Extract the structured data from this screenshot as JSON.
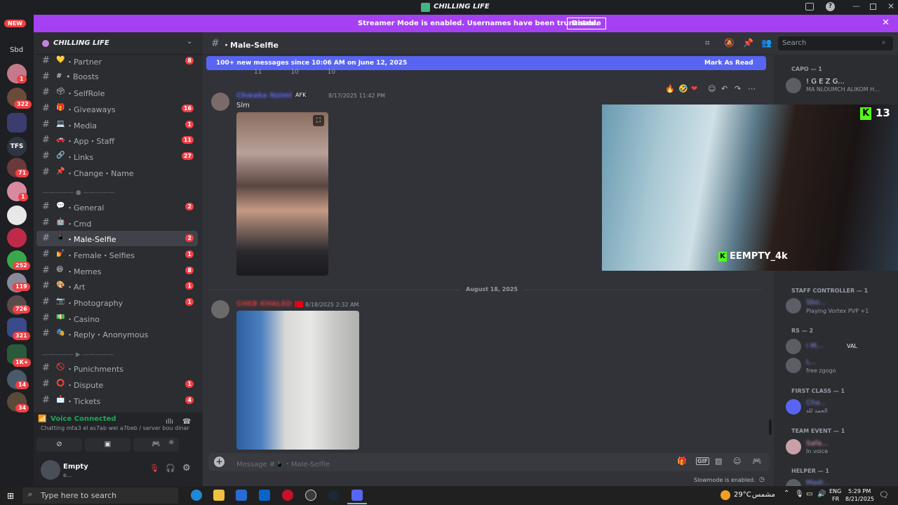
{
  "app": {
    "title": "CHILLING LIFE"
  },
  "banner": {
    "text": "Streamer Mode is enabled. Usernames have been truncated.",
    "button": "Disable"
  },
  "rail": {
    "new_label": "NEW",
    "sbd": "Sbd",
    "badges": [
      "1",
      "322",
      "71",
      "1",
      "252",
      "119",
      "726",
      "321",
      "1K+",
      "14",
      "34"
    ]
  },
  "sidebar": {
    "server_name": "CHILLING LIFE",
    "channels": [
      {
        "emoji": "💛",
        "name": "・Partner",
        "count": "8"
      },
      {
        "emoji": "#",
        "name": "• Boosts",
        "count": ""
      },
      {
        "emoji": "🗳",
        "name": "・SelfRole",
        "count": ""
      },
      {
        "emoji": "🎁",
        "name": "・Giveaways",
        "count": "16"
      },
      {
        "emoji": "💻",
        "name": "・Media",
        "count": "1"
      },
      {
        "emoji": "🚗",
        "name": "・App・Staff",
        "count": "11"
      },
      {
        "emoji": "🔗",
        "name": "・Links",
        "count": "27"
      },
      {
        "emoji": "📌",
        "name": "・Change・Name",
        "count": ""
      }
    ],
    "separator1": "————— ● —————",
    "channels2": [
      {
        "emoji": "💬",
        "name": "・General",
        "count": "2"
      },
      {
        "emoji": "🤖",
        "name": "・Cmd",
        "count": ""
      },
      {
        "emoji": "📱",
        "name": "・Male-Selfie",
        "count": "2",
        "active": true
      },
      {
        "emoji": "💅",
        "name": "・Female・Selfies",
        "count": "1"
      },
      {
        "emoji": "😆",
        "name": "・Memes",
        "count": "8"
      },
      {
        "emoji": "🎨",
        "name": "・Art",
        "count": "1"
      },
      {
        "emoji": "📷",
        "name": "・Photography",
        "count": "1"
      },
      {
        "emoji": "💵",
        "name": "・Casino",
        "count": ""
      },
      {
        "emoji": "🎭",
        "name": "・Reply・Anonymous",
        "count": ""
      }
    ],
    "separator2": "————— ▶ —————",
    "channels3": [
      {
        "emoji": "🚫",
        "name": "・Punichments",
        "count": ""
      },
      {
        "emoji": "⭕",
        "name": "・Dispute",
        "count": "1"
      },
      {
        "emoji": "📩",
        "name": "・Tickets",
        "count": "4"
      }
    ]
  },
  "voice": {
    "status": "Voice Connected",
    "channel": "Chatting mta3 el as7ab wel a7beb / server bou dinar"
  },
  "user": {
    "name": "Empty",
    "tag": "e..."
  },
  "chat": {
    "channel": "・Male-Selfie",
    "search_placeholder": "Search",
    "new_messages": "100+ new messages since 10:06 AM on June 12, 2025",
    "mark_read": "Mark As Read",
    "reactions": [
      "11",
      "10",
      "10"
    ],
    "msg1": {
      "author": "Chwaka Nzimi",
      "tag": "AFK",
      "time": "8/17/2025 11:42 PM",
      "text": "Slm"
    },
    "date_divider": "August 18, 2025",
    "msg2": {
      "author": "CHEB KHALED",
      "time": "8/18/2025 2:32 AM"
    },
    "composer_placeholder": "Message #📱・Male-Selfie",
    "slowmode": "Slowmode is enabled."
  },
  "cam": {
    "counter": "13",
    "overlay_name": "EEMPTY_4k"
  },
  "members": [
    {
      "role": "CAPO — 1",
      "name": "! G E Z G...",
      "activity": "MA NLOUMCH ALIKOM H..."
    },
    {
      "role": "STAFF CONTROLLER — 1",
      "name": "Sbo...",
      "activity": "Playing Vortex PVP +1"
    },
    {
      "role": "RS — 2",
      "name": "I M...",
      "activity": "VAL"
    },
    {
      "role": "",
      "name": "L...",
      "activity": "free zgogo"
    },
    {
      "role": "FIRST CLASS — 1",
      "name": "Cha...",
      "activity": "الحمد لله"
    },
    {
      "role": "TEAM EVENT — 1",
      "name": "Safa...",
      "activity": "In voice"
    },
    {
      "role": "HELPER — 1",
      "name": "Madr...",
      "activity": ""
    }
  ],
  "taskbar": {
    "search": "Type here to search",
    "weather": "29°C",
    "weather_label": "مشمس",
    "lang1": "ENG",
    "lang2": "FR",
    "time": "5:29 PM",
    "date": "8/21/2025"
  }
}
